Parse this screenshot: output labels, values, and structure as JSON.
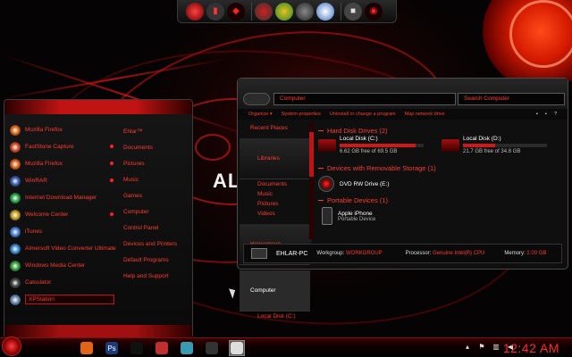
{
  "wallpaper": {
    "brand": "AL"
  },
  "dock": {
    "groups": [
      {
        "icons": [
          "alienware-orb-icon",
          "media-icon",
          "alien-head-icon"
        ]
      },
      {
        "icons": [
          "gadget-cpu-icon",
          "gadget-meter-icon",
          "gadget-user-icon",
          "clock-icon"
        ]
      },
      {
        "icons": [
          "cube-icon",
          "alien-eye-icon"
        ]
      }
    ]
  },
  "start_menu": {
    "programs": [
      {
        "label": "Mozilla Firefox",
        "icon": "firefox-icon",
        "color": "#e0651a",
        "submenu": false
      },
      {
        "label": "FastStone Capture",
        "icon": "faststone-icon",
        "color": "#d84b2a",
        "submenu": true
      },
      {
        "label": "Mozilla Firefox",
        "icon": "firefox-icon",
        "color": "#e0651a",
        "submenu": true
      },
      {
        "label": "WinRAR",
        "icon": "winrar-icon",
        "color": "#3a5fb0",
        "submenu": true
      },
      {
        "label": "Internet Download Manager",
        "icon": "idm-icon",
        "color": "#2aa84a",
        "submenu": false
      },
      {
        "label": "Welcome Center",
        "icon": "welcome-center-icon",
        "color": "#c8a020",
        "submenu": true
      },
      {
        "label": "iTunes",
        "icon": "itunes-icon",
        "color": "#4a80d8",
        "submenu": false
      },
      {
        "label": "Aimersoft Video Converter Ultimate",
        "icon": "aimersoft-icon",
        "color": "#3a8ad0",
        "submenu": false
      },
      {
        "label": "Windows Media Center",
        "icon": "media-center-icon",
        "color": "#3aa040",
        "submenu": false
      },
      {
        "label": "Calculator",
        "icon": "calculator-icon",
        "color": "#444444",
        "submenu": false
      },
      {
        "label": "XPStation",
        "icon": "xpstation-icon",
        "color": "#6a8ab0",
        "submenu": false
      }
    ],
    "selected_index": 10,
    "places": [
      "Ehlar™",
      "Documents",
      "Pictures",
      "Music",
      "Games",
      "Computer",
      "Control Panel",
      "Devices and Printers",
      "Default Programs",
      "Help and Support"
    ]
  },
  "explorer": {
    "address": "Computer",
    "search_placeholder": "Search Computer",
    "commands": [
      "Organize ▾",
      "System properties",
      "Uninstall or change a program",
      "Map network drive"
    ],
    "nav": [
      {
        "label": "Recent Places",
        "level": 0
      },
      {
        "label": "Libraries",
        "level": 1
      },
      {
        "label": "Documents",
        "level": 1
      },
      {
        "label": "Music",
        "level": 1
      },
      {
        "label": "Pictures",
        "level": 1
      },
      {
        "label": "Videos",
        "level": 1
      },
      {
        "label": "Homegroup",
        "level": 0
      },
      {
        "label": "Computer",
        "level": 0
      },
      {
        "label": "Local Disk (C:)",
        "level": 1
      }
    ],
    "groups": {
      "hdd": "Hard Disk Drives (2)",
      "removable": "Devices with Removable Storage (1)",
      "portable": "Portable Devices (1)"
    },
    "drives": [
      {
        "name": "Local Disk (C:)",
        "space": "6.62 GB free of 69.5 GB",
        "used_fraction": 0.9
      },
      {
        "name": "Local Disk (D:)",
        "space": "21.7 GB free of 34.8 GB",
        "used_fraction": 0.38
      }
    ],
    "removable": {
      "name": "DVD RW Drive (E:)"
    },
    "portable": {
      "name": "Apple iPhone",
      "sub": "Portable Device"
    },
    "details": {
      "pc_name": "EHLAR-PC",
      "workgroup_label": "Workgroup:",
      "workgroup": "WORKGROUP",
      "processor_label": "Processor:",
      "processor": "Genuine Intel(R) CPU",
      "memory_label": "Memory:",
      "memory": "2.00 GB"
    }
  },
  "taskbar": {
    "apps": [
      {
        "name": "firefox-icon",
        "active": false
      },
      {
        "name": "photoshop-icon",
        "glyph": "Ps",
        "active": false
      },
      {
        "name": "alien-head-icon",
        "active": false
      },
      {
        "name": "screenshot-app-icon",
        "active": false
      },
      {
        "name": "notepad-icon",
        "active": false
      },
      {
        "name": "media-player-icon",
        "active": false
      },
      {
        "name": "explorer-window-icon",
        "active": true
      }
    ],
    "clock": "12:42 AM"
  }
}
